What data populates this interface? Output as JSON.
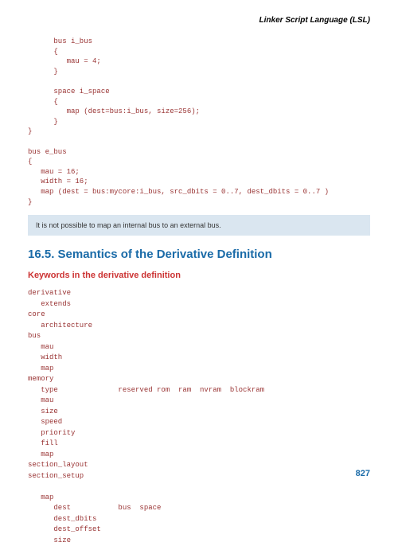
{
  "header": {
    "title": "Linker Script Language (LSL)"
  },
  "code1": "      bus i_bus\n      {\n         mau = 4;\n      }\n\n      space i_space\n      {\n         map (dest=bus:i_bus, size=256);\n      }\n}\n\nbus e_bus\n{\n   mau = 16;\n   width = 16;\n   map (dest = bus:mycore:i_bus, src_dbits = 0..7, dest_dbits = 0..7 )\n}",
  "note": "It is not possible to map an internal bus to an external bus.",
  "section_heading": "16.5. Semantics of the Derivative Definition",
  "subsection_heading": "Keywords in the derivative definition",
  "keywords": "derivative\n   extends\ncore\n   architecture\nbus\n   mau\n   width\n   map\nmemory\n   type              reserved rom  ram  nvram  blockram\n   mau\n   size\n   speed\n   priority\n   fill\n   map\nsection_layout\nsection_setup\n\n   map\n      dest           bus  space\n      dest_dbits\n      dest_offset\n      size",
  "page_number": "827"
}
